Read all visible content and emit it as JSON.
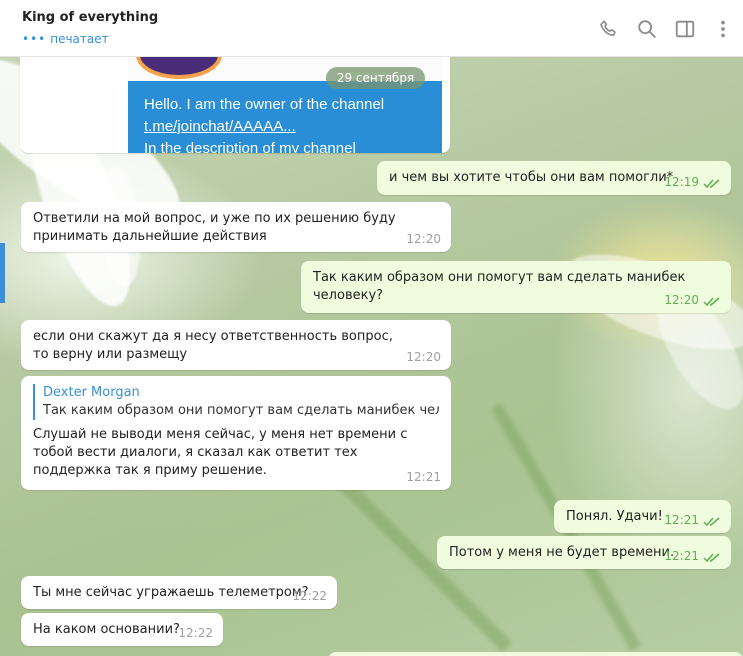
{
  "header": {
    "title": "King of everything",
    "status_dots": "•••",
    "status": "печатает",
    "icons": [
      "phone-icon",
      "search-icon",
      "sidebar-icon",
      "more-icon"
    ]
  },
  "forwarded_post": {
    "line1": "Hello. I am the owner of the channel",
    "line2": "t.me/joinchat/AAAAA...",
    "line3": "In the description of my channel"
  },
  "date_divider": "29 сентября",
  "messages": [
    {
      "dir": "out",
      "text": "и чем вы хотите чтобы они вам помогли*",
      "time": "12:19",
      "read": true
    },
    {
      "dir": "in",
      "text": "Ответили на мой вопрос, и уже по их решению буду принимать дальнейшие действия",
      "time": "12:20"
    },
    {
      "dir": "out",
      "text": "Так каким образом они помогут вам сделать манибек человеку?",
      "time": "12:20",
      "read": true
    },
    {
      "dir": "in",
      "text": "если они скажут да я несу ответственность вопрос, то верну или размещу",
      "time": "12:20"
    },
    {
      "dir": "in",
      "reply_author": "Dexter Morgan",
      "reply_text": "Так каким образом они помогут вам сделать манибек челов...",
      "text": "Слушай не выводи меня сейчас, у меня нет времени с тобой вести диалоги, я сказал как ответит тех поддержка так я приму решение.",
      "time": "12:21"
    },
    {
      "dir": "out",
      "text": "Понял. Удачи!",
      "time": "12:21",
      "read": true
    },
    {
      "dir": "out",
      "text": "Потом у меня не будет времени.",
      "time": "12:21",
      "read": true
    },
    {
      "dir": "in",
      "text": "Ты мне сейчас угражаешь телеметром?",
      "time": "12:22"
    },
    {
      "dir": "in",
      "text": "На каком основании?",
      "time": "12:22"
    }
  ],
  "colors": {
    "accent": "#3a8fd6",
    "outgoing_bubble": "#effdde",
    "incoming_bubble": "#ffffff",
    "read_check": "#62ac55"
  }
}
